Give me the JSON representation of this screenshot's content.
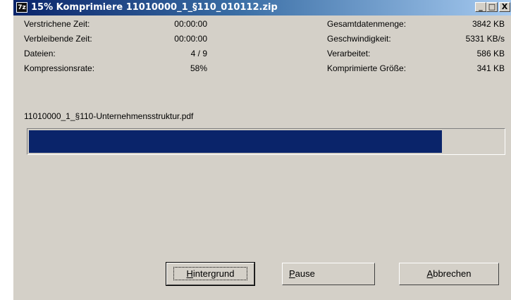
{
  "window": {
    "icon_text": "7z",
    "title": "15% Komprimiere 11010000_1_§110_010112.zip",
    "controls": {
      "minimize": "_",
      "maximize": "□",
      "close": "X"
    }
  },
  "stats_left": [
    {
      "label": "Verstrichene Zeit:",
      "value": "00:00:00"
    },
    {
      "label": "Verbleibende Zeit:",
      "value": "00:00:00"
    },
    {
      "label": "Dateien:",
      "value": "4 / 9"
    },
    {
      "label": "Kompressionsrate:",
      "value": "58%"
    }
  ],
  "stats_right": [
    {
      "label": "Gesamtdatenmenge:",
      "value": "3842 KB"
    },
    {
      "label": "Geschwindigkeit:",
      "value": "5331 KB/s"
    },
    {
      "label": "Verarbeitet:",
      "value": "586 KB"
    },
    {
      "label": "Komprimierte Größe:",
      "value": "341 KB"
    }
  ],
  "current_file": "11010000_1_§110-Unternehmensstruktur.pdf",
  "progress_fraction": 0.87,
  "buttons": {
    "background": {
      "accel": "H",
      "rest": "intergrund"
    },
    "pause": {
      "accel": "P",
      "rest": "ause"
    },
    "cancel": {
      "accel": "A",
      "rest": "bbrechen"
    }
  },
  "colors": {
    "progress_fill": "#0a246a",
    "window_bg": "#d4d0c8"
  }
}
